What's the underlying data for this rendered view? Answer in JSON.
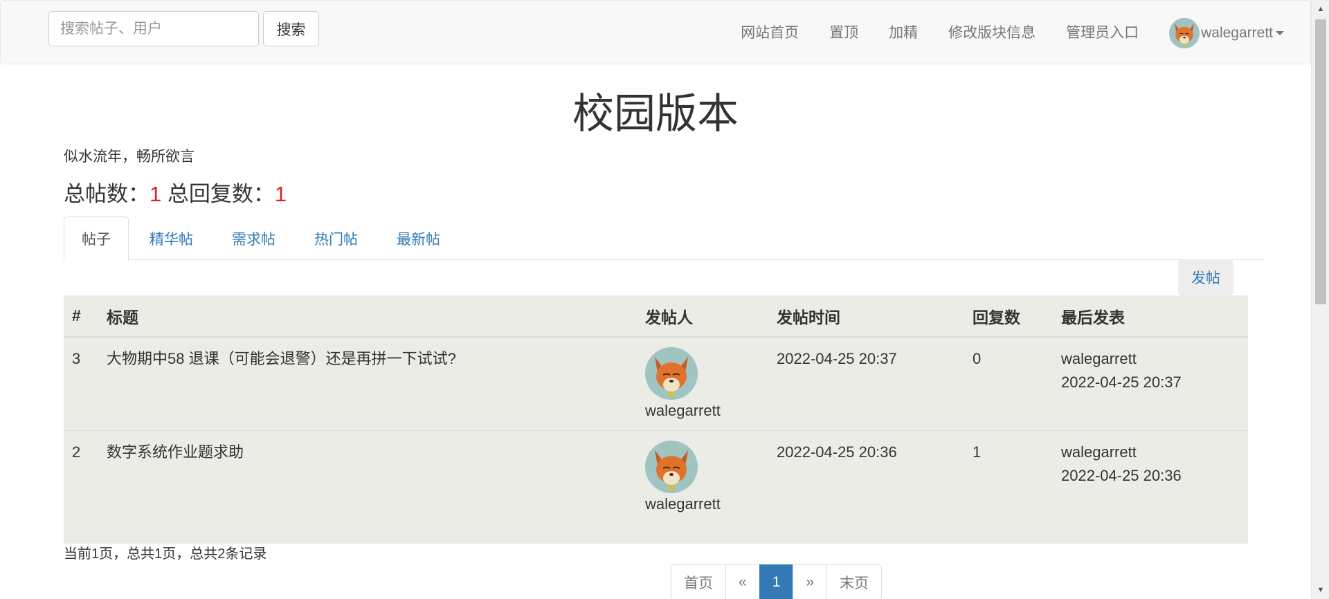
{
  "search": {
    "placeholder": "搜索帖子、用户",
    "button_label": "搜索"
  },
  "nav": {
    "links": [
      "网站首页",
      "置顶",
      "加精",
      "修改版块信息",
      "管理员入口"
    ],
    "username": "walegarrett",
    "avatar_icon": "fox-avatar-icon"
  },
  "header": {
    "title": "校园版本",
    "subtitle": "似水流年，畅所欲言",
    "posts_label": "总帖数：",
    "posts_count": "1",
    "replies_label": "总回复数：",
    "replies_count": "1"
  },
  "tabs": [
    {
      "label": "帖子",
      "active": true
    },
    {
      "label": "精华帖",
      "active": false
    },
    {
      "label": "需求帖",
      "active": false
    },
    {
      "label": "热门帖",
      "active": false
    },
    {
      "label": "最新帖",
      "active": false
    }
  ],
  "post_button": "发帖",
  "table": {
    "headers": [
      "#",
      "标题",
      "发帖人",
      "发帖时间",
      "回复数",
      "最后发表"
    ],
    "rows": [
      {
        "id": "3",
        "title": "大物期中58 退课（可能会退警）还是再拼一下试试?",
        "author": "walegarrett",
        "time": "2022-04-25 20:37",
        "replies": "0",
        "last_user": "walegarrett",
        "last_time": "2022-04-25 20:37"
      },
      {
        "id": "2",
        "title": "数字系统作业题求助",
        "author": "walegarrett",
        "time": "2022-04-25 20:36",
        "replies": "1",
        "last_user": "walegarrett",
        "last_time": "2022-04-25 20:36"
      }
    ]
  },
  "pagination": {
    "info": "当前1页，总共1页，总共2条记录",
    "first": "首页",
    "prev": "«",
    "current": "1",
    "next": "»",
    "last": "末页"
  },
  "colors": {
    "link": "#337ab7",
    "count_highlight": "#d9232d",
    "table_bg": "#ecece7",
    "navbar_bg": "#f8f8f8"
  }
}
